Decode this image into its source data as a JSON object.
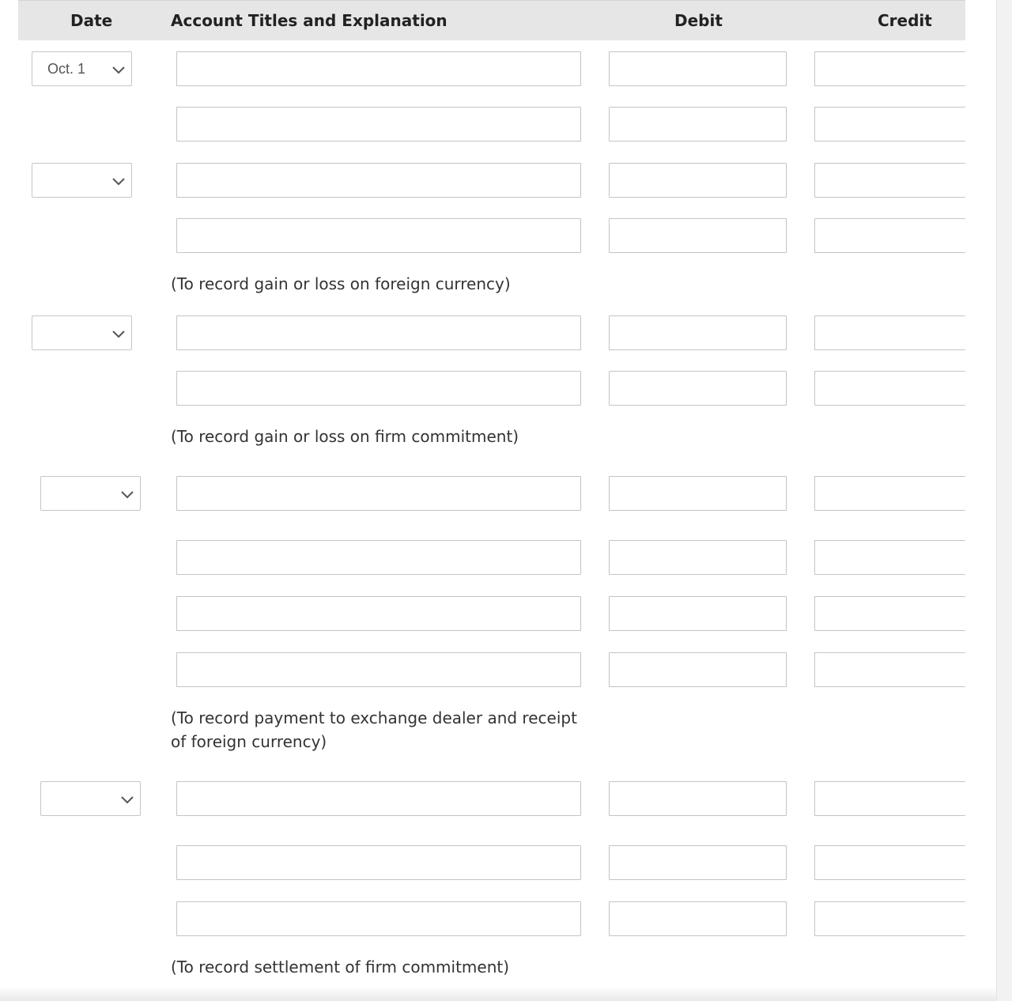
{
  "header": {
    "date": "Date",
    "account": "Account Titles and Explanation",
    "debit": "Debit",
    "credit": "Credit"
  },
  "entries": {
    "date1": "Oct. 1",
    "date2": "",
    "date3": "",
    "date4": "",
    "date5": ""
  },
  "notes": {
    "note1": "(To record gain or loss on foreign currency)",
    "note2": "(To record gain or loss on firm commitment)",
    "note3": "(To record payment to exchange dealer and receipt of foreign currency)",
    "note4": "(To record settlement of firm commitment)"
  },
  "icons": {
    "dropdown": "chevron-down-icon"
  }
}
